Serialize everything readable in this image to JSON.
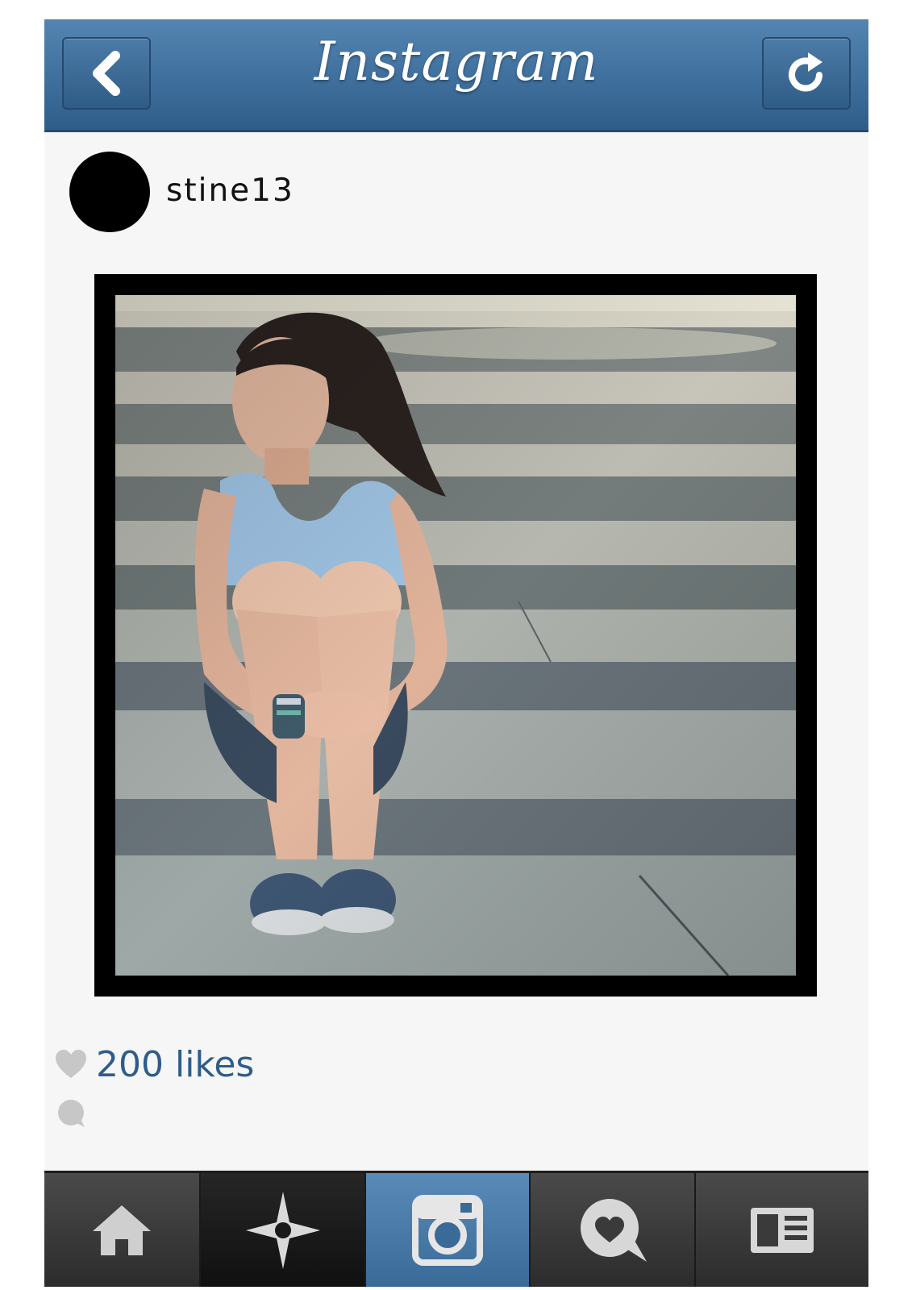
{
  "header": {
    "title": "Instagram",
    "back_icon": "chevron-left-icon",
    "refresh_icon": "refresh-icon"
  },
  "post": {
    "username": "stine13",
    "likes_text": "200 likes",
    "photo_description_icon": "photo-image"
  },
  "tabbar": {
    "tabs": [
      {
        "icon": "home-icon",
        "state": "normal"
      },
      {
        "icon": "explore-star-icon",
        "state": "dark"
      },
      {
        "icon": "camera-icon",
        "state": "active"
      },
      {
        "icon": "news-heart-bubble-icon",
        "state": "normal"
      },
      {
        "icon": "profile-card-icon",
        "state": "normal"
      }
    ]
  },
  "colors": {
    "header_blue": "#3f6f9c",
    "likes_blue": "#2f5d8a",
    "active_tab": "#4a7aa7",
    "background": "#f6f6f6"
  }
}
